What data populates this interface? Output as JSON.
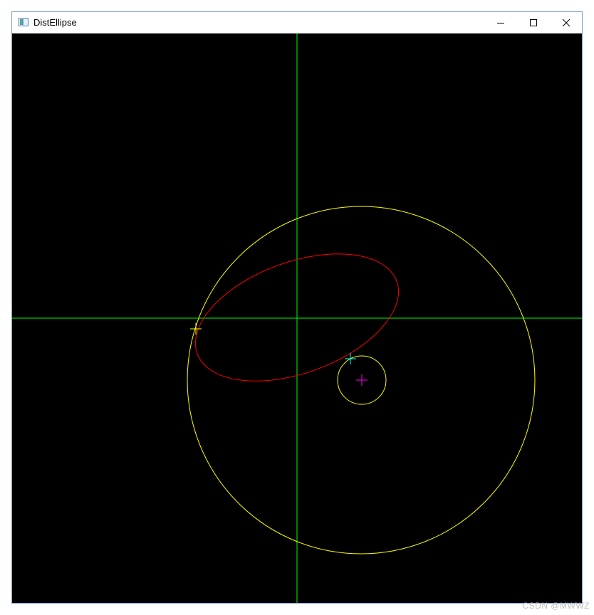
{
  "window": {
    "title": "DistEllipse",
    "controls": {
      "minimize_icon": "minimize-icon",
      "maximize_icon": "maximize-icon",
      "close_icon": "close-icon"
    }
  },
  "scene": {
    "background_color": "#000000",
    "axis_color": "#00ff00",
    "ellipse_color": "#ff0000",
    "circle_color": "#ffff00",
    "closest_point_color": "#00ffff",
    "center_marker_color": "#ff00ff",
    "ellipse_point_marker_color": "#ffff00"
  },
  "watermark": "CSDN @MWWZ"
}
